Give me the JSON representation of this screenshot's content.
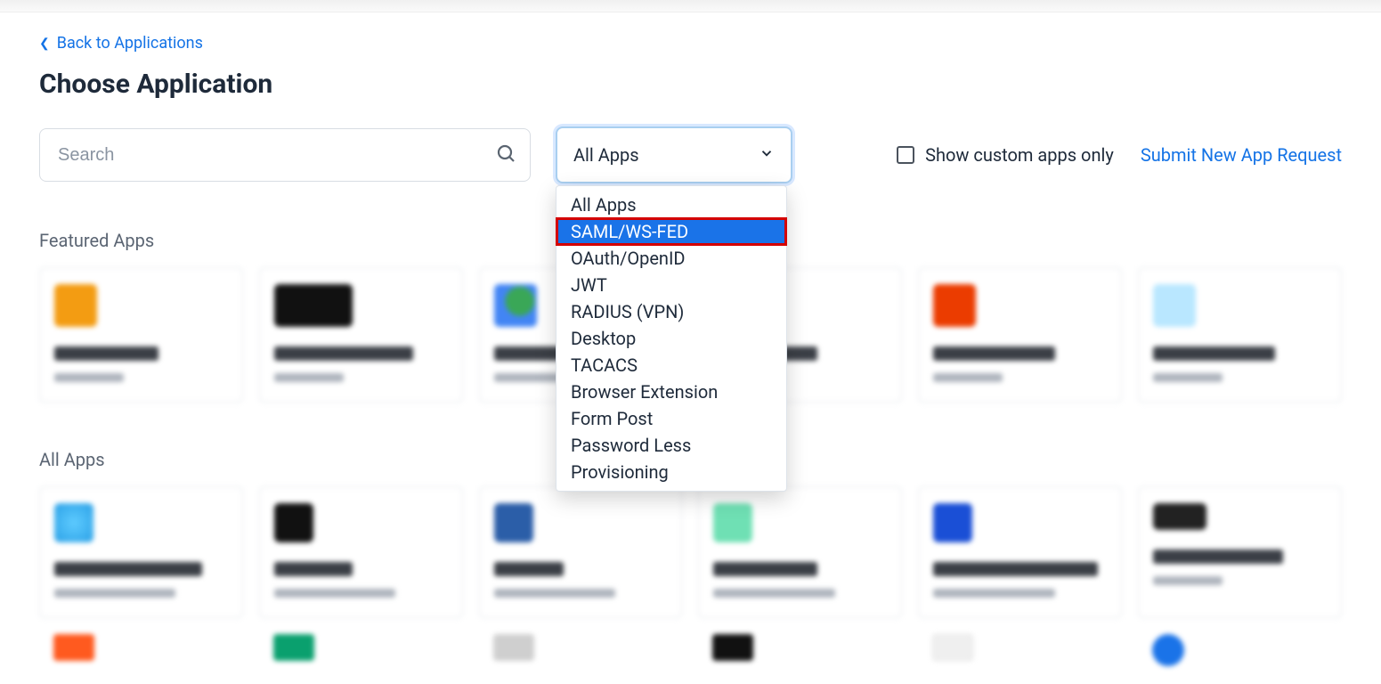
{
  "nav": {
    "back_label": "Back to Applications"
  },
  "header": {
    "title": "Choose Application"
  },
  "search": {
    "placeholder": "Search"
  },
  "filter": {
    "selected": "All Apps",
    "options": [
      "All Apps",
      "SAML/WS-FED",
      "OAuth/OpenID",
      "JWT",
      "RADIUS (VPN)",
      "Desktop",
      "TACACS",
      "Browser Extension",
      "Form Post",
      "Password Less",
      "Provisioning"
    ],
    "highlight_index": 1
  },
  "right": {
    "checkbox_label": "Show custom apps only",
    "submit_label": "Submit New App Request"
  },
  "sections": {
    "featured": "Featured Apps",
    "all": "All Apps"
  }
}
